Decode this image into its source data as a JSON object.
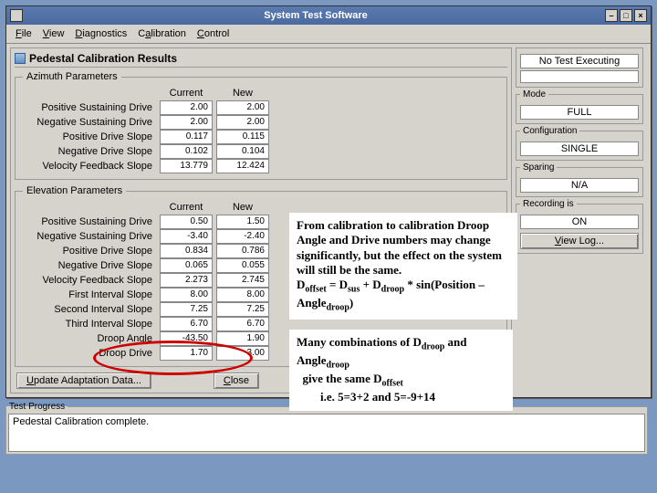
{
  "window": {
    "title": "System Test Software"
  },
  "menu": {
    "file": "File",
    "view": "View",
    "diag": "Diagnostics",
    "calib": "Calibration",
    "control": "Control"
  },
  "panel": {
    "title": "Pedestal Calibration Results",
    "az_legend": "Azimuth Parameters",
    "el_legend": "Elevation Parameters",
    "col_current": "Current",
    "col_new": "New",
    "az": {
      "r0": {
        "label": "Positive Sustaining Drive",
        "cur": "2.00",
        "new": "2.00"
      },
      "r1": {
        "label": "Negative Sustaining Drive",
        "cur": "2.00",
        "new": "2.00"
      },
      "r2": {
        "label": "Positive Drive Slope",
        "cur": "0.117",
        "new": "0.115"
      },
      "r3": {
        "label": "Negative Drive Slope",
        "cur": "0.102",
        "new": "0.104"
      },
      "r4": {
        "label": "Velocity Feedback Slope",
        "cur": "13.779",
        "new": "12.424"
      }
    },
    "el": {
      "r0": {
        "label": "Positive Sustaining Drive",
        "cur": "0.50",
        "new": "1.50"
      },
      "r1": {
        "label": "Negative Sustaining Drive",
        "cur": "-3.40",
        "new": "-2.40"
      },
      "r2": {
        "label": "Positive Drive Slope",
        "cur": "0.834",
        "new": "0.786"
      },
      "r3": {
        "label": "Negative Drive Slope",
        "cur": "0.065",
        "new": "0.055"
      },
      "r4": {
        "label": "Velocity Feedback Slope",
        "cur": "2.273",
        "new": "2.745"
      },
      "r5": {
        "label": "First Interval Slope",
        "cur": "8.00",
        "new": "8.00"
      },
      "r6": {
        "label": "Second Interval Slope",
        "cur": "7.25",
        "new": "7.25"
      },
      "r7": {
        "label": "Third Interval Slope",
        "cur": "6.70",
        "new": "6.70"
      },
      "r8": {
        "label": "Droop Angle",
        "cur": "-43.50",
        "new": "1.90"
      },
      "r9": {
        "label": "Droop Drive",
        "cur": "1.70",
        "new": "3.00"
      }
    },
    "btn_update": "Update Adaptation Data...",
    "btn_close": "Close"
  },
  "right": {
    "no_test": "No Test Executing",
    "mode_legend": "Mode",
    "mode_val": "FULL",
    "config_legend": "Configuration",
    "config_val": "SINGLE",
    "sparing_legend": "Sparing",
    "sparing_val": "N/A",
    "recording_legend": "Recording is",
    "recording_val": "ON",
    "view_log": "View Log..."
  },
  "progress": {
    "legend": "Test Progress",
    "text": "Pedestal Calibration complete."
  },
  "annot": {
    "body_1": "From calibration to calibration Droop Angle and Drive numbers may change significantly, but the effect on the system will still be the same.",
    "formula_prefix": "D",
    "formula_sub1": "offset",
    "formula_eq": " = D",
    "formula_sub2": "sus",
    "formula_plus": " + D",
    "formula_sub3": "droop",
    "formula_mid": " * sin(Position – Angle",
    "formula_sub4": "droop",
    "formula_end": ")",
    "body_2a": "Many combinations of D",
    "body_2a_sub": "droop",
    "body_2b": " and Angle",
    "body_2b_sub": "droop",
    "body_3": " give the same D",
    "body_3_sub": "offset",
    "body_4": "i.e. 5=3+2 and 5=-9+14"
  }
}
